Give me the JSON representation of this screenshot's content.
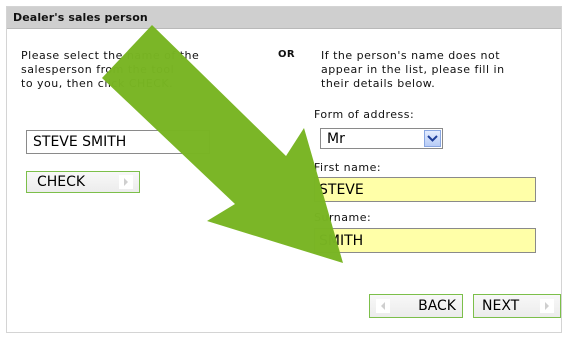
{
  "panel": {
    "title": "Dealer's sales person"
  },
  "left": {
    "instructions": "Please select the name of the\nsalesperson from the tool\nto you, then click CHECK.",
    "salesperson_value": "STEVE SMITH",
    "check_label": "CHECK"
  },
  "divider": {
    "or_label": "OR"
  },
  "right": {
    "instructions": "If the person's name does not\nappear in the list, please fill in\ntheir details below.",
    "form_of_address_label": "Form of address:",
    "form_of_address_value": "Mr",
    "first_name_label": "First name:",
    "first_name_value": "STEVE",
    "surname_label": "Surname:",
    "surname_value": "SMITH"
  },
  "navigation": {
    "back_label": "BACK",
    "next_label": "NEXT"
  },
  "colors": {
    "arrow_green": "#78b523",
    "button_border": "#7cbf4a",
    "input_yellow": "#ffffa8",
    "header_gray": "#cfcfcf"
  },
  "icons": {
    "dropdown": "chevron-down-icon",
    "back": "chevron-left-icon",
    "next": "chevron-right-icon",
    "check": "chevron-right-icon",
    "overlay_arrow": "pointer-arrow-icon"
  }
}
